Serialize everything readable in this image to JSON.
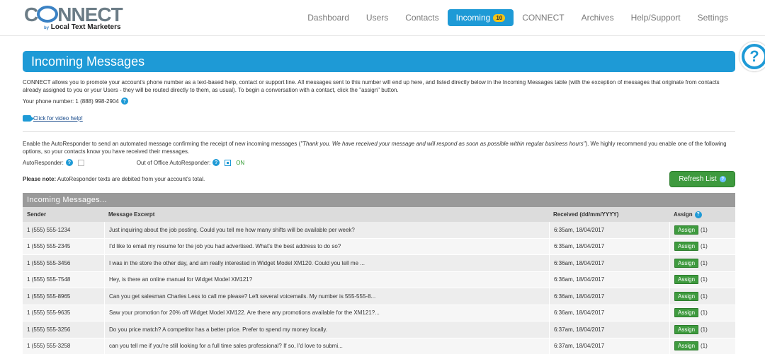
{
  "brand": {
    "logo_text_main_1": "C",
    "logo_text_main_2": "NNECT",
    "logo_by": "by",
    "logo_sub": "Local Text Marketers"
  },
  "nav": {
    "items": [
      {
        "label": "Dashboard"
      },
      {
        "label": "Users"
      },
      {
        "label": "Contacts"
      },
      {
        "label": "Incoming",
        "badge": "10",
        "active": true
      },
      {
        "label": "CONNECT"
      },
      {
        "label": "Archives"
      },
      {
        "label": "Help/Support"
      },
      {
        "label": "Settings"
      }
    ]
  },
  "help_float": {
    "icon": "question-mark-icon",
    "glyph": "?"
  },
  "page": {
    "title": "Incoming Messages",
    "intro": "CONNECT allows you to promote your account's phone number as a text-based help, contact or support line. All messages sent to this number will end up here, and listed directly below in the Incoming Messages table (with the exception of messages that originate from contacts already assigned to you or your Users - they will be routed directly to them, as usual). To begin a conversation with a contact, click the \"assign\" button.",
    "phone_label": "Your phone number: 1 (888) 998-2904",
    "video_link": "Click for video help!",
    "autoresponder_text_1": "Enable the AutoResponder to send an automated message confirming the receipt of new incoming messages (",
    "autoresponder_text_quote": "\"Thank you. We have received your message and will respond as soon as possible within regular business hours\"",
    "autoresponder_text_2": "). We highly recommend you enable one of the following options, so your contacts know you have received their messages.",
    "autoresponder_label": "AutoResponder:",
    "ooo_label": "Out of Office AutoResponder:",
    "ooo_state": "ON",
    "note_bold": "Please note:",
    "note_text": " AutoResponder texts are debited from your account's total.",
    "refresh_label": "Refresh List"
  },
  "table": {
    "title": "Incoming Messages...",
    "headers": {
      "sender": "Sender",
      "excerpt": "Message Excerpt",
      "received": "Received (dd/mm/YYYY)",
      "assign": "Assign"
    },
    "assign_button": "Assign",
    "assign_count": "(1)",
    "rows": [
      {
        "sender": "1 (555) 555-1234",
        "excerpt": "Just inquiring about the job posting. Could you tell me how many shifts will be available per week?",
        "received": "6:35am, 18/04/2017"
      },
      {
        "sender": "1 (555) 555-2345",
        "excerpt": "I'd like to email my resume for the job you had advertised. What's the best address to do so?",
        "received": "6:35am, 18/04/2017"
      },
      {
        "sender": "1 (555) 555-3456",
        "excerpt": "I was in the store the other day, and am really interested in Widget Model XM120. Could you tell me ...",
        "received": "6:36am, 18/04/2017"
      },
      {
        "sender": "1 (555) 555-7548",
        "excerpt": "Hey, is there an online manual for Widget Model XM121?",
        "received": "6:36am, 18/04/2017"
      },
      {
        "sender": "1 (555) 555-8965",
        "excerpt": "Can you get salesman Charles Less to call me please? Left several voicemails. My number is 555-555-8...",
        "received": "6:36am, 18/04/2017"
      },
      {
        "sender": "1 (555) 555-9635",
        "excerpt": "Saw your promotion for 20% off Widget Model XM122. Are there any promotions available for the XM121?...",
        "received": "6:36am, 18/04/2017"
      },
      {
        "sender": "1 (555) 555-3256",
        "excerpt": "Do you price match? A competitor has a better price. Prefer to spend my money locally.",
        "received": "6:37am, 18/04/2017"
      },
      {
        "sender": "1 (555) 555-3258",
        "excerpt": "can you tell me if you're still looking for a full time sales professional? If so, I'd love to submi...",
        "received": "6:37am, 18/04/2017"
      }
    ]
  },
  "colors": {
    "accent": "#1e9ad6",
    "assign_green": "#3e9a3e",
    "badge_yellow": "#f5c518"
  }
}
